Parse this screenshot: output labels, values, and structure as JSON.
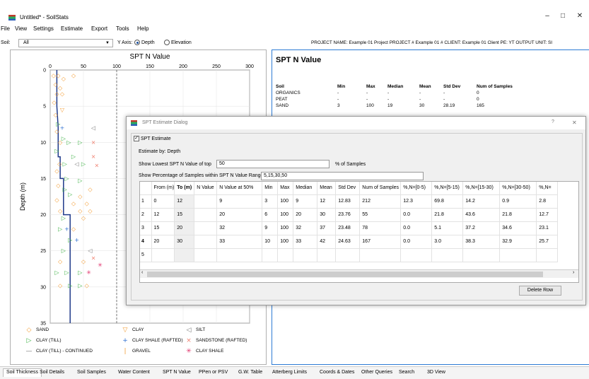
{
  "window": {
    "title": "Untitled* - SoilStats",
    "min": "–",
    "max": "□",
    "close": "✕"
  },
  "menu": [
    "File",
    "View",
    "Settings",
    "Estimate",
    "Export",
    "Tools",
    "Help"
  ],
  "toolbar": {
    "soil_label": "Soil:",
    "soil_value": "All",
    "yaxis_label": "Y Axis:",
    "opt_depth": "Depth",
    "opt_elev": "Elevation",
    "project_info": "PROJECT NAME: Example 01 Project  PROJECT # Example 01 #  CLIENT: Example 01 Client  PE: YT  OUTPUT UNIT: SI"
  },
  "chart_data": {
    "type": "scatter",
    "title": "SPT N Value",
    "ylabel": "Depth (m)",
    "xlabel": "",
    "x_ticks": [
      0,
      50,
      100,
      150,
      200,
      250,
      300
    ],
    "y_ticks": [
      0,
      5,
      10,
      15,
      20,
      25,
      30,
      35
    ],
    "xlim": [
      0,
      300
    ],
    "ylim": [
      0,
      35
    ],
    "grid": true,
    "y_inverted": true,
    "legend_placement": "bottom",
    "legend": [
      {
        "name": "SAND",
        "symbol": "◇",
        "color": "#f39c33"
      },
      {
        "name": "CLAY",
        "symbol": "▽",
        "color": "#f39c33"
      },
      {
        "name": "SILT",
        "symbol": "◁",
        "color": "#777777"
      },
      {
        "name": "CLAY (TILL)",
        "symbol": "▷",
        "color": "#3cb043"
      },
      {
        "name": "CLAY SHALE (RAFTED)",
        "symbol": "+",
        "color": "#2e6fd0"
      },
      {
        "name": "SANDSTONE (RAFTED)",
        "symbol": "×",
        "color": "#f08070"
      },
      {
        "name": "CLAY (TILL) - CONTINUED",
        "symbol": "—",
        "color": "#777777"
      },
      {
        "name": "GRAVEL",
        "symbol": "|",
        "color": "#f39c33"
      },
      {
        "name": "CLAY SHALE",
        "symbol": "✳",
        "color": "#e0306a"
      }
    ],
    "points": [
      {
        "s": 0,
        "x": 5,
        "y": 0.8
      },
      {
        "s": 0,
        "x": 12,
        "y": 0.8
      },
      {
        "s": 0,
        "x": 20,
        "y": 1.2
      },
      {
        "s": 0,
        "x": 35,
        "y": 0.8
      },
      {
        "s": 0,
        "x": 8,
        "y": 2
      },
      {
        "s": 0,
        "x": 15,
        "y": 2.5
      },
      {
        "s": 0,
        "x": 10,
        "y": 3.3
      },
      {
        "s": 0,
        "x": 18,
        "y": 3.3
      },
      {
        "s": 0,
        "x": 6,
        "y": 4.5
      },
      {
        "s": 1,
        "x": 18,
        "y": 5.5
      },
      {
        "s": 0,
        "x": 8,
        "y": 6.2
      },
      {
        "s": 3,
        "x": 12,
        "y": 7.5
      },
      {
        "s": 4,
        "x": 18,
        "y": 8
      },
      {
        "s": 2,
        "x": 65,
        "y": 8
      },
      {
        "s": 0,
        "x": 10,
        "y": 8.5
      },
      {
        "s": 3,
        "x": 20,
        "y": 9.5
      },
      {
        "s": 3,
        "x": 28,
        "y": 10
      },
      {
        "s": 3,
        "x": 45,
        "y": 10
      },
      {
        "s": 0,
        "x": 15,
        "y": 10
      },
      {
        "s": 5,
        "x": 65,
        "y": 10
      },
      {
        "s": 3,
        "x": 10,
        "y": 11.2
      },
      {
        "s": 3,
        "x": 35,
        "y": 12
      },
      {
        "s": 5,
        "x": 65,
        "y": 12
      },
      {
        "s": 0,
        "x": 14,
        "y": 13
      },
      {
        "s": 3,
        "x": 22,
        "y": 13
      },
      {
        "s": 3,
        "x": 50,
        "y": 13
      },
      {
        "s": 2,
        "x": 40,
        "y": 13
      },
      {
        "s": 5,
        "x": 70,
        "y": 13.2
      },
      {
        "s": 0,
        "x": 10,
        "y": 14
      },
      {
        "s": 3,
        "x": 25,
        "y": 15
      },
      {
        "s": 3,
        "x": 45,
        "y": 15.3
      },
      {
        "s": 0,
        "x": 12,
        "y": 16
      },
      {
        "s": 3,
        "x": 22,
        "y": 16.5
      },
      {
        "s": 0,
        "x": 60,
        "y": 16.5
      },
      {
        "s": 3,
        "x": 30,
        "y": 17.2
      },
      {
        "s": 0,
        "x": 45,
        "y": 17.5
      },
      {
        "s": 0,
        "x": 10,
        "y": 18
      },
      {
        "s": 0,
        "x": 35,
        "y": 18.5
      },
      {
        "s": 0,
        "x": 55,
        "y": 18.5
      },
      {
        "s": 0,
        "x": 15,
        "y": 19.5
      },
      {
        "s": 0,
        "x": 45,
        "y": 19.5
      },
      {
        "s": 0,
        "x": 60,
        "y": 19.5
      },
      {
        "s": 3,
        "x": 20,
        "y": 20.5
      },
      {
        "s": 0,
        "x": 50,
        "y": 20.5
      },
      {
        "s": 3,
        "x": 15,
        "y": 22
      },
      {
        "s": 0,
        "x": 35,
        "y": 22
      },
      {
        "s": 4,
        "x": 25,
        "y": 22
      },
      {
        "s": 3,
        "x": 30,
        "y": 23.5
      },
      {
        "s": 4,
        "x": 40,
        "y": 23.5
      },
      {
        "s": 2,
        "x": 60,
        "y": 25
      },
      {
        "s": 3,
        "x": 20,
        "y": 25
      },
      {
        "s": 0,
        "x": 15,
        "y": 26.5
      },
      {
        "s": 0,
        "x": 50,
        "y": 26.5
      },
      {
        "s": 8,
        "x": 75,
        "y": 27
      },
      {
        "s": 5,
        "x": 65,
        "y": 26
      },
      {
        "s": 3,
        "x": 25,
        "y": 28
      },
      {
        "s": 3,
        "x": 45,
        "y": 28
      },
      {
        "s": 8,
        "x": 58,
        "y": 28
      },
      {
        "s": 3,
        "x": 10,
        "y": 28
      },
      {
        "s": 0,
        "x": 15,
        "y": 29.8
      },
      {
        "s": 3,
        "x": 30,
        "y": 29.8
      },
      {
        "s": 0,
        "x": 55,
        "y": 29.8
      },
      {
        "s": 3,
        "x": 45,
        "y": 29.8
      }
    ],
    "median_line": [
      [
        10,
        0
      ],
      [
        10,
        5
      ],
      [
        12,
        8
      ],
      [
        12,
        12
      ],
      [
        15,
        12
      ],
      [
        15,
        15
      ],
      [
        20,
        15
      ],
      [
        20,
        20
      ],
      [
        30,
        20
      ],
      [
        30,
        30
      ],
      [
        30,
        35
      ]
    ]
  },
  "report": {
    "title": "SPT N Value",
    "headers": [
      "Soil",
      "Min",
      "Max",
      "Median",
      "Mean",
      "Std Dev",
      "Num of Samples"
    ],
    "rows": [
      [
        "ORGANICS",
        "-",
        "-",
        "-",
        "-",
        "-",
        "0"
      ],
      [
        "PEAT",
        "-",
        "-",
        "-",
        "-",
        "-",
        "0"
      ],
      [
        "SAND",
        "3",
        "100",
        "19",
        "30",
        "28.19",
        "165"
      ]
    ]
  },
  "dialog": {
    "title": "SPT Estimate Dialog",
    "help": "?",
    "close": "✕",
    "check_label": "SPT Estimate",
    "estimate_by": "Estimate by: Depth",
    "lowest_label": "Show Lowest SPT N Value of top",
    "lowest_value": "50",
    "lowest_suffix": "% of Samples",
    "ranges_label": "Show Percentage of Samples within SPT N Value Ranges:",
    "ranges_value": "5,15,30,50",
    "columns": [
      "",
      "From (m)",
      "To (m)",
      "N Value",
      "N Value at 50%",
      "Min",
      "Max",
      "Median",
      "Mean",
      "Std Dev",
      "Num of Samples",
      "%,N=[0-5)",
      "%,N=[5-15)",
      "%,N=[15-30)",
      "%,N=[30-50)",
      "%,N="
    ],
    "rows": [
      [
        "1",
        "0",
        "12",
        "",
        "9",
        "3",
        "100",
        "9",
        "12",
        "12.83",
        "212",
        "12.3",
        "69.8",
        "14.2",
        "0.9",
        "2.8"
      ],
      [
        "2",
        "12",
        "15",
        "",
        "20",
        "6",
        "100",
        "20",
        "30",
        "23.76",
        "55",
        "0.0",
        "21.8",
        "43.6",
        "21.8",
        "12.7"
      ],
      [
        "3",
        "15",
        "20",
        "",
        "32",
        "9",
        "100",
        "32",
        "37",
        "23.48",
        "78",
        "0.0",
        "5.1",
        "37.2",
        "34.6",
        "23.1"
      ],
      [
        "4",
        "20",
        "30",
        "",
        "33",
        "10",
        "100",
        "33",
        "42",
        "24.63",
        "167",
        "0.0",
        "3.0",
        "38.3",
        "32.9",
        "25.7"
      ],
      [
        "5",
        "",
        "",
        "",
        "",
        "",
        "",
        "",
        "",
        "",
        "",
        "",
        "",
        "",
        "",
        ""
      ]
    ],
    "delete_label": "Delete Row"
  },
  "tabs": [
    "Soil Thickness",
    "Soil Details",
    "Soil Samples",
    "Water Content",
    "SPT N Value",
    "PPen or PSV",
    "G.W. Table",
    "Atterberg Limits",
    "Coords & Dates",
    "Other Queries",
    "Search",
    "3D View"
  ]
}
